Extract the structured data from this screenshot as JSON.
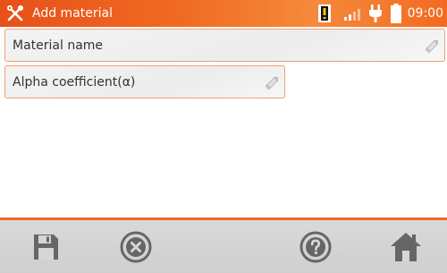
{
  "header": {
    "title": "Add material",
    "time": "09:00",
    "tool_icon": "wrench-screwdriver-icon",
    "status_icons": [
      "sd-card-icon",
      "signal-bars-icon",
      "power-plug-icon",
      "battery-icon"
    ]
  },
  "form": {
    "material_name": {
      "placeholder": "Material name",
      "edit_icon": "pencil-icon"
    },
    "alpha_coefficient": {
      "placeholder": "Alpha coefficient(α)",
      "edit_icon": "pencil-icon"
    }
  },
  "toolbar": {
    "buttons": [
      {
        "name": "save",
        "icon": "floppy-disk-icon"
      },
      {
        "name": "cancel",
        "icon": "close-circle-icon"
      },
      {
        "name": "help",
        "icon": "question-circle-icon"
      },
      {
        "name": "home",
        "icon": "home-icon"
      }
    ]
  },
  "colors": {
    "accent": "#ef6a22",
    "field_border": "#f0a070",
    "toolbar_bg": "#d4d4d4",
    "icon_gray": "#666666"
  }
}
